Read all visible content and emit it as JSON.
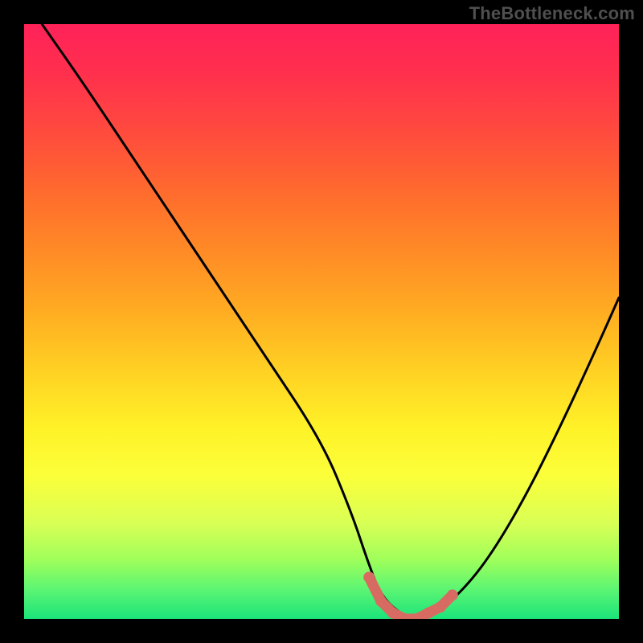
{
  "watermark": "TheBottleneck.com",
  "colors": {
    "background": "#000000",
    "curve": "#000000",
    "marker": "#d76b62",
    "gradient_top": "#ff2259",
    "gradient_bottom": "#1be47a"
  },
  "chart_data": {
    "type": "line",
    "title": "",
    "xlabel": "",
    "ylabel": "",
    "xlim": [
      0,
      100
    ],
    "ylim": [
      0,
      100
    ],
    "grid": false,
    "background": "vertical-gradient-red-orange-yellow-green",
    "series": [
      {
        "name": "bottleneck-curve",
        "style": "black-line",
        "x": [
          3,
          10,
          20,
          30,
          40,
          50,
          55,
          58,
          60,
          63,
          66,
          69,
          73,
          78,
          84,
          90,
          96,
          100
        ],
        "y": [
          100,
          90,
          75,
          60,
          45,
          30,
          18,
          9,
          4,
          1,
          0,
          1,
          4,
          10,
          20,
          32,
          45,
          54
        ]
      }
    ],
    "markers": {
      "name": "optimal-range",
      "style": "pink-points",
      "x": [
        58,
        60,
        62,
        64,
        66,
        68,
        70,
        72
      ],
      "y": [
        7,
        3,
        1,
        0,
        0,
        1,
        2,
        4
      ]
    }
  }
}
